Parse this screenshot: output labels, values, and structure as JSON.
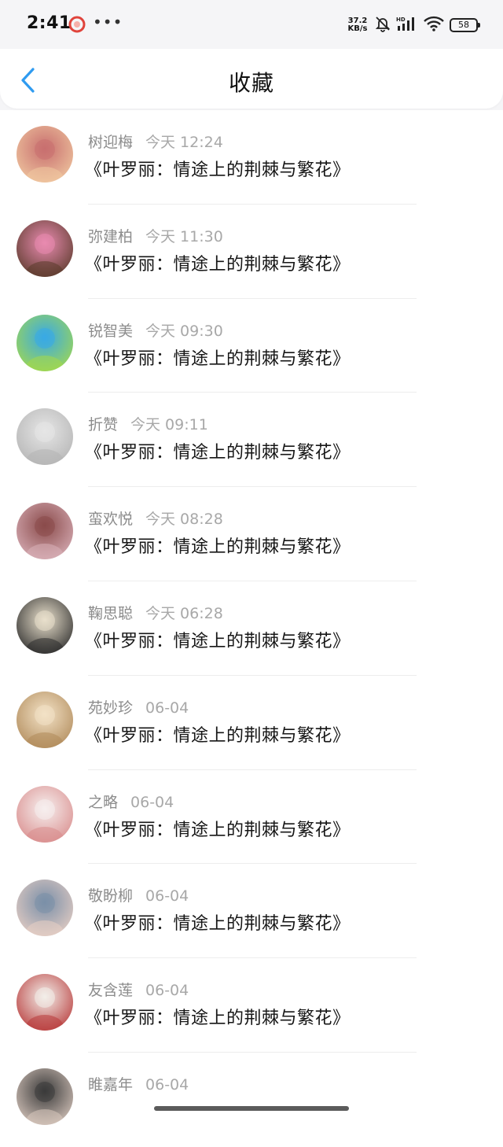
{
  "status_bar": {
    "time": "2:41",
    "more_dots": "•••",
    "net_speed_value": "37.2",
    "net_speed_unit": "KB/s",
    "battery_level": "58",
    "app_icon": "red-ring-icon",
    "icons": [
      "mute-bell-icon",
      "signal-icon",
      "wifi-icon",
      "battery-icon"
    ],
    "network_label": "HD"
  },
  "header": {
    "title": "收藏",
    "back_icon": "chevron-left-icon",
    "accent_color": "#2f9bf0"
  },
  "favorites": [
    {
      "name": "树迎梅",
      "time": "今天 12:24",
      "title": "《叶罗丽：情途上的荆棘与繁花》",
      "avatar_colors": [
        "#c86f6f",
        "#f0c8a0"
      ]
    },
    {
      "name": "弥建柏",
      "time": "今天 11:30",
      "title": "《叶罗丽：情途上的荆棘与繁花》",
      "avatar_colors": [
        "#e98bb0",
        "#5a3a2a"
      ]
    },
    {
      "name": "锐智美",
      "time": "今天 09:30",
      "title": "《叶罗丽：情途上的荆棘与繁花》",
      "avatar_colors": [
        "#39a9e6",
        "#a4d94a"
      ]
    },
    {
      "name": "折赞",
      "time": "今天 09:11",
      "title": "《叶罗丽：情途上的荆棘与繁花》",
      "avatar_colors": [
        "#e6e6e6",
        "#b4b4b4"
      ]
    },
    {
      "name": "蛮欢悦",
      "time": "今天 08:28",
      "title": "《叶罗丽：情途上的荆棘与繁花》",
      "avatar_colors": [
        "#8a4b4b",
        "#d9b0b8"
      ]
    },
    {
      "name": "鞠思聪",
      "time": "今天 06:28",
      "title": "《叶罗丽：情途上的荆棘与繁花》",
      "avatar_colors": [
        "#e9e0cc",
        "#2b2b2b"
      ]
    },
    {
      "name": "苑妙珍",
      "time": "06-04",
      "title": "《叶罗丽：情途上的荆棘与繁花》",
      "avatar_colors": [
        "#f3e2c6",
        "#b08a5a"
      ]
    },
    {
      "name": "之略",
      "time": "06-04",
      "title": "《叶罗丽：情途上的荆棘与繁花》",
      "avatar_colors": [
        "#f6efee",
        "#d98c8c"
      ]
    },
    {
      "name": "敬盼柳",
      "time": "06-04",
      "title": "《叶罗丽：情途上的荆棘与繁花》",
      "avatar_colors": [
        "#7a8fa8",
        "#e8cfc4"
      ]
    },
    {
      "name": "友含莲",
      "time": "06-04",
      "title": "《叶罗丽：情途上的荆棘与繁花》",
      "avatar_colors": [
        "#f2eee9",
        "#b83a3a"
      ]
    },
    {
      "name": "睢嘉年",
      "time": "06-04",
      "title": "",
      "avatar_colors": [
        "#3a3a3a",
        "#d9c8be"
      ]
    }
  ]
}
